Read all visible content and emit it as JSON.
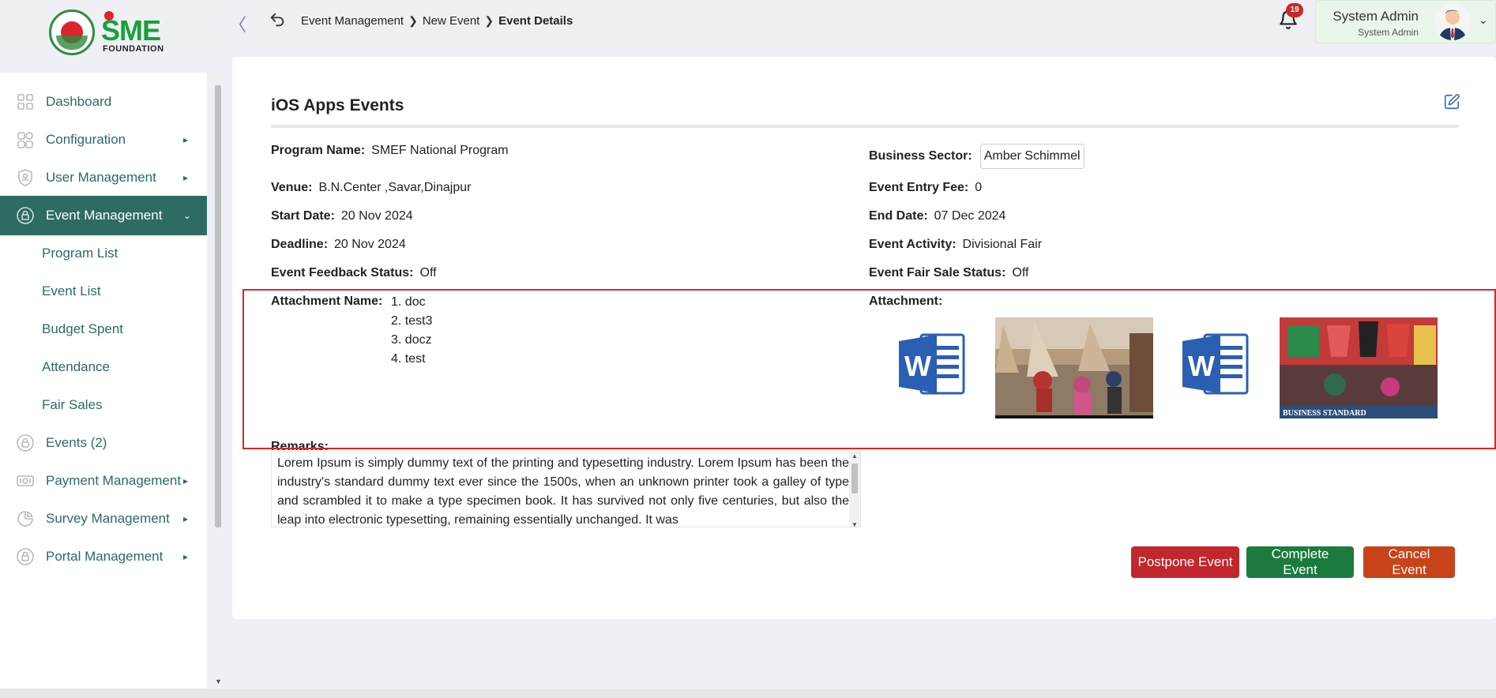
{
  "brand": {
    "logo_text": "SME",
    "logo_subtitle": "FOUNDATION"
  },
  "header": {
    "breadcrumb": [
      "Event Management",
      "New Event",
      "Event Details"
    ],
    "notification_count": "19",
    "user_name": "System Admin",
    "user_role": "System Admin"
  },
  "sidebar": {
    "items": [
      {
        "label": "Dashboard",
        "icon": "grid-icon"
      },
      {
        "label": "Configuration",
        "icon": "config-icon",
        "arrow": "▸"
      },
      {
        "label": "User Management",
        "icon": "shield-icon",
        "arrow": "▸"
      },
      {
        "label": "Event Management",
        "icon": "lock-icon",
        "arrow": "⌄",
        "active": true
      },
      {
        "label": "Events (2)",
        "icon": "lock-icon"
      },
      {
        "label": "Payment Management",
        "icon": "payment-icon",
        "arrow": "▸"
      },
      {
        "label": "Survey Management",
        "icon": "pie-icon",
        "arrow": "▸"
      },
      {
        "label": "Portal Management",
        "icon": "lock-icon",
        "arrow": "▸"
      }
    ],
    "sub_items": [
      "Program List",
      "Event List",
      "Budget Spent",
      "Attendance",
      "Fair Sales"
    ]
  },
  "event": {
    "title": "iOS Apps Events",
    "program_name_label": "Program Name:",
    "program_name": "SMEF National Program",
    "business_sector_label": "Business Sector:",
    "business_sector": "Amber Schimmel",
    "venue_label": "Venue:",
    "venue": "B.N.Center ,Savar,Dinajpur",
    "entry_fee_label": "Event Entry Fee:",
    "entry_fee": "0",
    "start_date_label": "Start Date:",
    "start_date": "20 Nov 2024",
    "end_date_label": "End Date:",
    "end_date": "07 Dec 2024",
    "deadline_label": "Deadline:",
    "deadline": "20 Nov 2024",
    "activity_label": "Event Activity:",
    "activity": "Divisional Fair",
    "feedback_label": "Event Feedback Status:",
    "feedback": "Off",
    "fair_sale_label": "Event Fair Sale Status:",
    "fair_sale": "Off",
    "attachment_name_label": "Attachment Name:",
    "attachment_names": [
      "1. doc",
      "2. test3",
      "3. docz",
      "4. test"
    ],
    "attachment_label": "Attachment:",
    "photo_caption": "BUSINESS STANDARD",
    "remarks_label": "Remarks:",
    "remarks": "Lorem Ipsum is simply dummy text of the printing and typesetting industry. Lorem Ipsum has been the industry's standard dummy text ever since the 1500s, when an unknown printer took a galley of type and scrambled it to make a type specimen book. It has survived not only five centuries, but also the leap into electronic typesetting, remaining essentially unchanged. It was"
  },
  "actions": {
    "postpone": "Postpone Event",
    "complete": "Complete Event",
    "cancel": "Cancel Event"
  },
  "colors": {
    "sidebar_active": "#2e6b60",
    "postpone": "#c1272d",
    "complete": "#1c7a3e",
    "cancel": "#c8421a",
    "highlight": "#e02424"
  }
}
